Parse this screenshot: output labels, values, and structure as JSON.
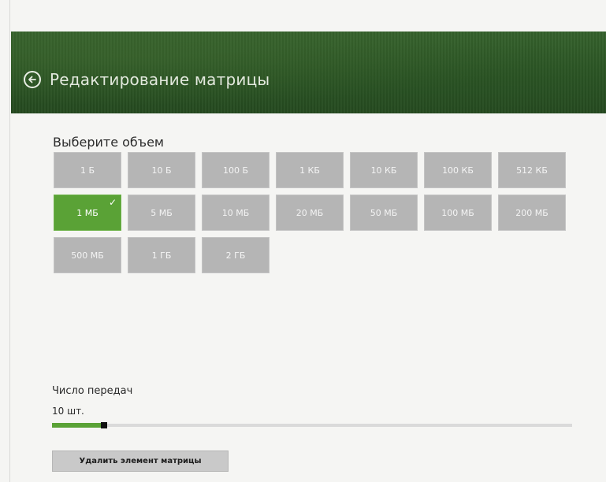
{
  "header": {
    "title": "Редактирование матрицы",
    "back_icon": "arrow-left-circle-icon"
  },
  "volume": {
    "label": "Выберите объем",
    "selected": "1 МБ",
    "rows": [
      [
        "1 Б",
        "10 Б",
        "100 Б",
        "1 КБ",
        "10 КБ",
        "100 КБ",
        "512 КБ"
      ],
      [
        "1 МБ",
        "5 МБ",
        "10 МБ",
        "20 МБ",
        "50 МБ",
        "100 МБ",
        "200 МБ"
      ],
      [
        "500 МБ",
        "1 ГБ",
        "2 ГБ"
      ]
    ]
  },
  "transfers": {
    "label": "Число передач",
    "value_text": "10 шт.",
    "slider_fraction": 0.1
  },
  "actions": {
    "delete_label": "Удалить элемент матрицы"
  },
  "colors": {
    "accent": "#5aa236",
    "tile": "#b5b5b5",
    "header": "#2b5524"
  }
}
